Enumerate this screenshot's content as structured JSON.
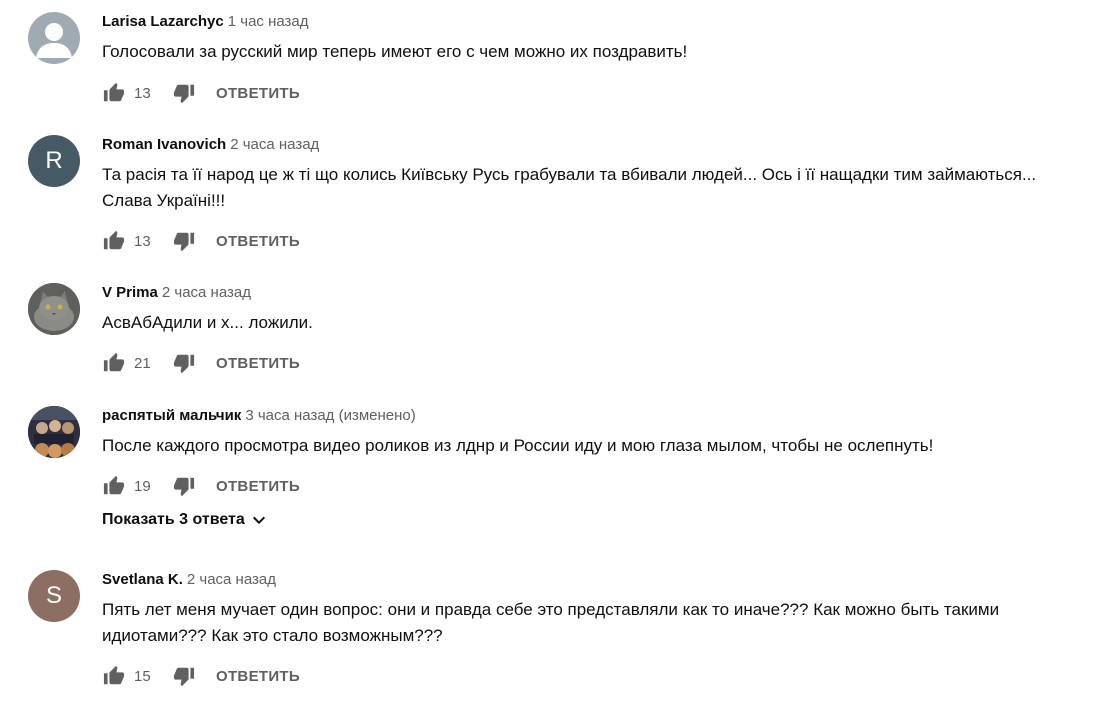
{
  "comments": [
    {
      "author": "Larisa Lazarchyc",
      "time": "1 час назад",
      "text": "Голосовали за русский мир теперь имеют его с чем можно их поздравить!",
      "likes": "13",
      "reply_label": "ОТВЕТИТЬ",
      "avatar_letter": "",
      "avatar_color": "#a0aab3"
    },
    {
      "author": "Roman Ivanovich",
      "time": "2 часа назад",
      "text": "Та расія та її народ це ж ті що колись Київську Русь грабували та вбивали людей... Ось і її нащадки тим займаються... Слава Україні!!!",
      "likes": "13",
      "reply_label": "ОТВЕТИТЬ",
      "avatar_letter": "R",
      "avatar_color": "#455a64"
    },
    {
      "author": "V Prima",
      "time": "2 часа назад",
      "text": "АсвАбАдили и х... ложили.",
      "likes": "21",
      "reply_label": "ОТВЕТИТЬ",
      "avatar_letter": "",
      "avatar_color": "#6e6f6a"
    },
    {
      "author": "распятый мальчик",
      "time": "3 часа назад (изменено)",
      "text": "После каждого просмотра видео роликов из лднр и России иду и мою глаза мылом, чтобы не ослепнуть!",
      "likes": "19",
      "reply_label": "ОТВЕТИТЬ",
      "avatar_letter": "",
      "avatar_color": "#3b3e4a",
      "show_replies": "Показать 3 ответа"
    },
    {
      "author": "Svetlana K.",
      "time": "2 часа назад",
      "text": "Пять лет меня мучает один вопрос: они и правда себе это представляли как то иначе??? Как можно быть такими идиотами??? Как это стало возможным???",
      "likes": "15",
      "reply_label": "ОТВЕТИТЬ",
      "avatar_letter": "S",
      "avatar_color": "#8d6e63"
    }
  ],
  "icons": {
    "like": "thumb-up-icon",
    "dislike": "thumb-down-icon",
    "expand": "chevron-down-icon"
  }
}
